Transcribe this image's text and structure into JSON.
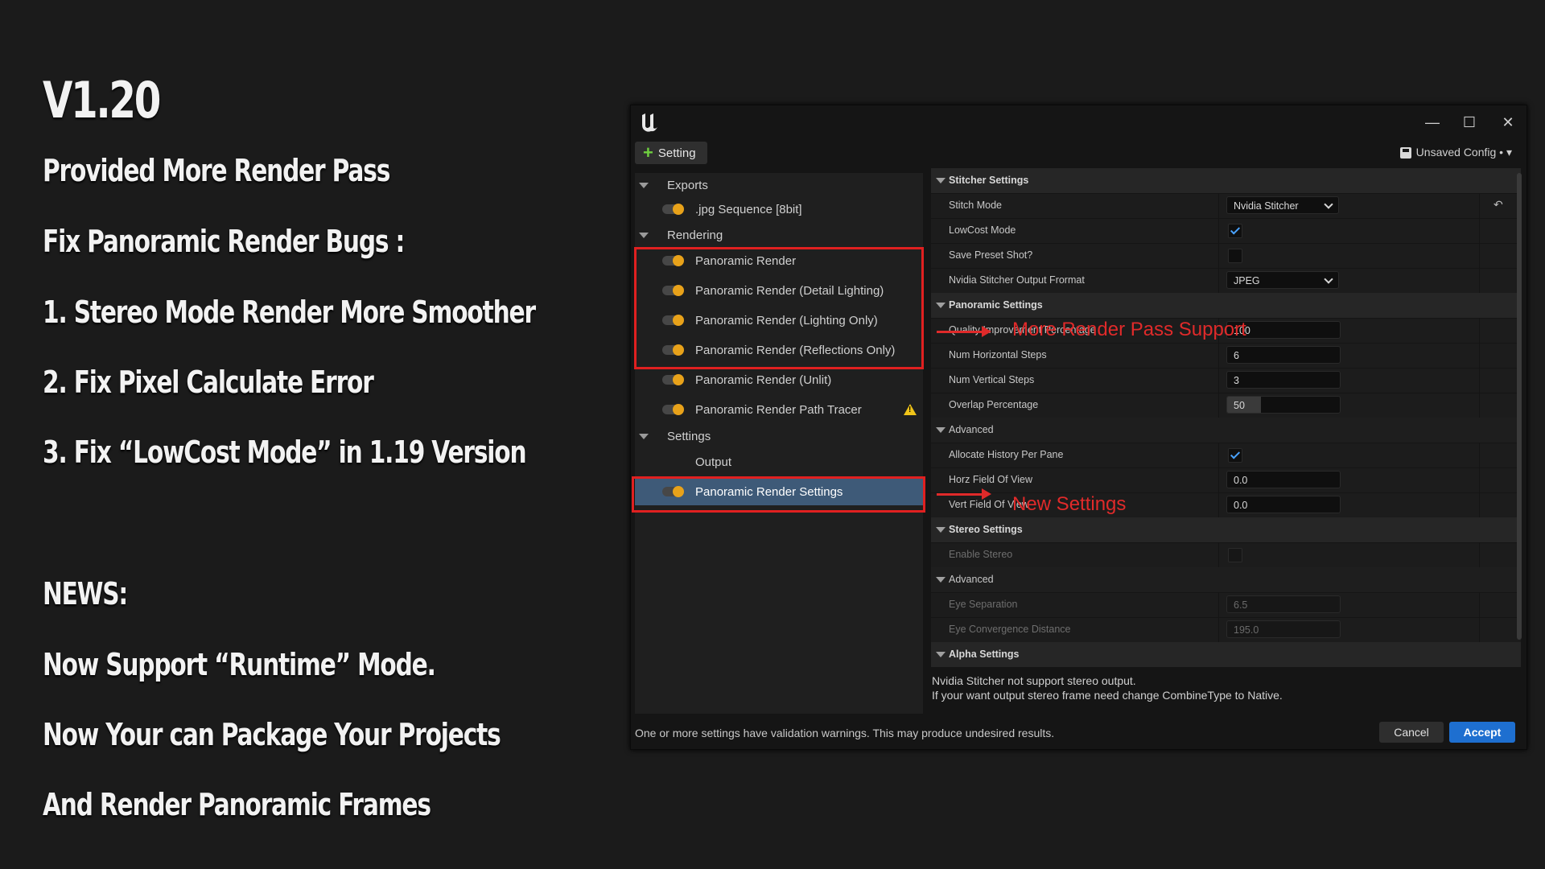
{
  "promo": {
    "version": "V1.20",
    "lines": [
      "Provided More Render Pass",
      "Fix Panoramic Render Bugs :",
      "1. Stereo Mode Render  More Smoother",
      "2. Fix Pixel Calculate Error",
      "3. Fix “LowCost Mode” in 1.19 Version",
      "NEWS:",
      "Now Support  “Runtime”  Mode.",
      "Now Your can Package Your Projects",
      "And Render Panoramic Frames"
    ]
  },
  "window": {
    "minimize_glyph": "—",
    "maximize_glyph": "☐",
    "close_glyph": "✕",
    "add_button_label": "Setting",
    "config_label": "Unsaved Config • ▾"
  },
  "tree": {
    "exports_label": "Exports",
    "jpg_label": ".jpg Sequence [8bit]",
    "rendering_label": "Rendering",
    "render_items": [
      "Panoramic Render",
      "Panoramic Render (Detail Lighting)",
      "Panoramic Render (Lighting Only)",
      "Panoramic Render (Reflections Only)",
      "Panoramic Render (Unlit)",
      "Panoramic Render Path Tracer"
    ],
    "settings_label": "Settings",
    "output_label": "Output",
    "panoramic_settings_label": "Panoramic Render Settings"
  },
  "props": {
    "stitcher_section": "Stitcher Settings",
    "stitch_mode_label": "Stitch Mode",
    "stitch_mode_value": "Nvidia Stitcher",
    "lowcost_label": "LowCost Mode",
    "save_preset_label": "Save Preset Shot?",
    "output_format_label": "Nvidia Stitcher Output Frormat",
    "output_format_value": "JPEG",
    "panoramic_section": "Panoramic Settings",
    "quality_label": "Quality Improvement Percentage",
    "quality_value": "100",
    "hsteps_label": "Num Horizontal Steps",
    "hsteps_value": "6",
    "vsteps_label": "Num Vertical Steps",
    "vsteps_value": "3",
    "overlap_label": "Overlap Percentage",
    "overlap_value": "50",
    "overlap_fraction": 0.3,
    "advanced_label": "Advanced",
    "alloc_label": "Allocate History Per Pane",
    "hfov_label": "Horz Field Of View",
    "hfov_value": "0.0",
    "vfov_label": "Vert Field Of View",
    "vfov_value": "0.0",
    "stereo_section": "Stereo Settings",
    "enable_stereo_label": "Enable Stereo",
    "advanced2_label": "Advanced",
    "eye_sep_label": "Eye Separation",
    "eye_sep_value": "6.5",
    "eye_conv_label": "Eye Convergence Distance",
    "eye_conv_value": "195.0",
    "alpha_section": "Alpha Settings"
  },
  "message": {
    "line1": "Nvidia Stitcher not support stereo output.",
    "line2": "If your want output stereo frame need change CombineType to Native."
  },
  "status_text": "One or more settings have validation warnings. This may produce undesired results.",
  "buttons": {
    "cancel": "Cancel",
    "accept": "Accept"
  },
  "annotations": {
    "more_passes": "More Render Pass Support",
    "new_settings": "New Settings"
  },
  "colors": {
    "accent": "#1e6fd0",
    "highlight_box": "#e02020",
    "toggle_on": "#e8a21a",
    "selection": "#3e5a78"
  }
}
